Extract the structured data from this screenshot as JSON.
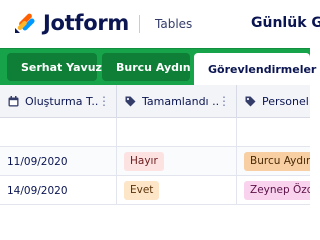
{
  "header": {
    "brand": "Jotform",
    "product": "Tables",
    "title": "Günlük G"
  },
  "tabs": [
    {
      "label": "Serhat Yavuz",
      "icon": "table-icon",
      "active": false
    },
    {
      "label": "Burcu Aydın",
      "icon": "table-icon",
      "active": false
    },
    {
      "label": "Görevlendirmeler",
      "icon": "table-icon",
      "active": true
    }
  ],
  "columns": [
    {
      "label": "Oluşturma T...",
      "icon": "calendar-icon"
    },
    {
      "label": "Tamamlandı ...",
      "icon": "tag-icon"
    },
    {
      "label": "Personel A",
      "icon": "tag-icon"
    }
  ],
  "rows": [
    {
      "date": "",
      "tamamlandi": "",
      "personel": ""
    },
    {
      "date": "11/09/2020",
      "tamamlandi": "Hayır",
      "personel": "Burcu Aydın"
    },
    {
      "date": "14/09/2020",
      "tamamlandi": "Evet",
      "personel": "Zeynep Özde"
    }
  ],
  "colors": {
    "brand_green": "#17a34a",
    "pill_hayir": "#fde2e2",
    "pill_evet": "#fde6c8",
    "pill_burcu": "#f8cfa2",
    "pill_zeynep": "#f9d3ee"
  }
}
